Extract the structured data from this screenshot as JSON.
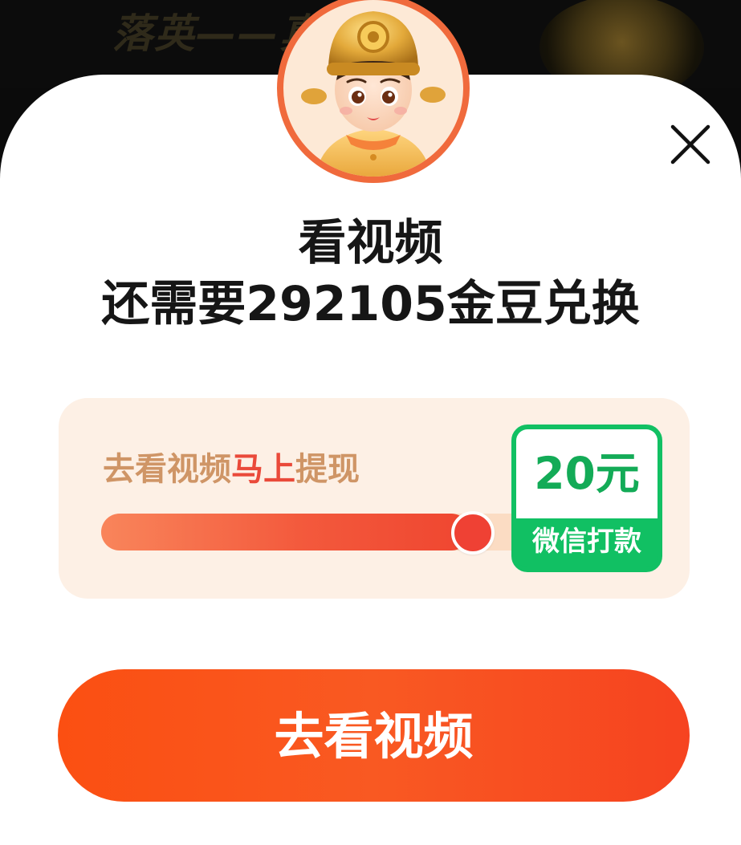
{
  "background": {
    "text": "落英——真正的"
  },
  "avatar": {
    "icon": "god-of-wealth-avatar-icon",
    "ring_color": "#f06a3c"
  },
  "close": {
    "icon": "close-icon"
  },
  "title": {
    "line1": "看视频",
    "line2": "还需要292105金豆兑换"
  },
  "progress_card": {
    "label_prefix": "去看视频",
    "label_highlight": "马上",
    "label_suffix": "提现",
    "progress_fraction": 0.765,
    "reward_amount": "20元",
    "reward_method": "微信打款",
    "accent_color": "#11c063"
  },
  "cta": {
    "label": "去看视频",
    "color": "#fb4f12"
  }
}
